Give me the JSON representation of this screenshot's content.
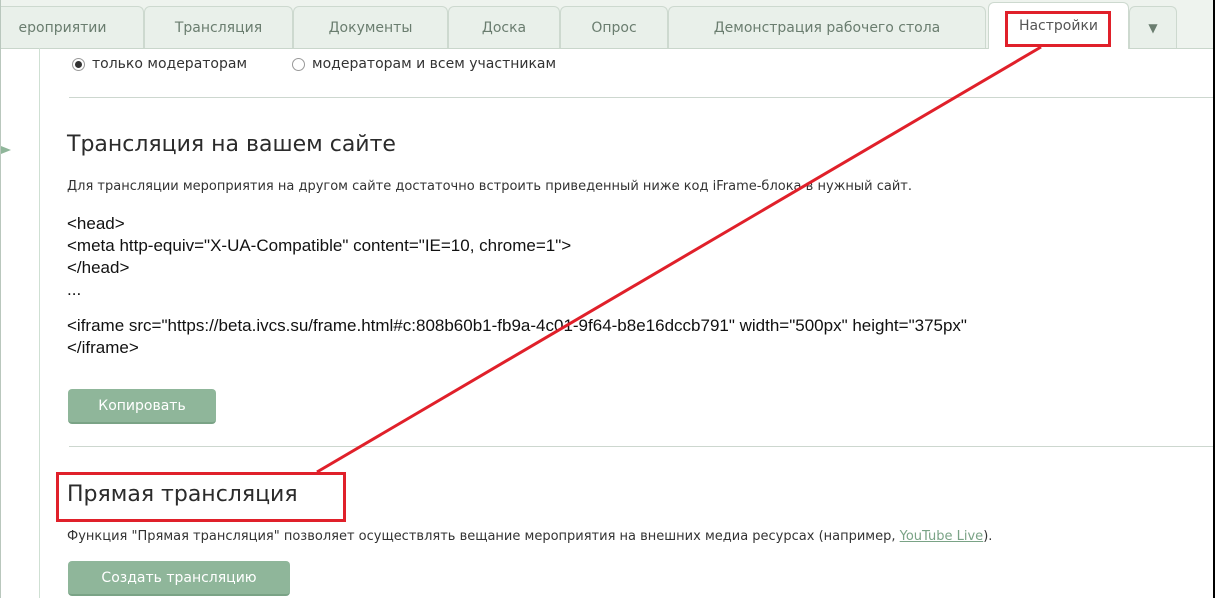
{
  "tabs": [
    {
      "label": "ероприятии"
    },
    {
      "label": "Трансляция"
    },
    {
      "label": "Документы"
    },
    {
      "label": "Доска"
    },
    {
      "label": "Опрос"
    },
    {
      "label": "Демонстрация рабочего стола"
    },
    {
      "label": "Настройки"
    }
  ],
  "tab_more_icon": "▼",
  "access": {
    "option1": "только модераторам",
    "option2": "модераторам и всем участникам",
    "selected": "только модераторам"
  },
  "embed": {
    "title": "Трансляция на вашем сайте",
    "description": "Для трансляции мероприятия на другом сайте достаточно встроить приведенный ниже код iFrame-блока в нужный сайт.",
    "code_lines": [
      "<head>",
      "<meta http-equiv=\"X-UA-Compatible\" content=\"IE=10, chrome=1\">",
      "</head>",
      "...",
      "<iframe src=\"https://beta.ivcs.su/frame.html#c:808b60b1-fb9a-4c01-9f64-b8e16dccb791\" width=\"500px\" height=\"375px\"",
      "</iframe>"
    ],
    "copy_button": "Копировать"
  },
  "live": {
    "title": "Прямая трансляция",
    "description_prefix": "Функция \"Прямая трансляция\" позволяет осуществлять вещание мероприятия на внешних медиа ресурсах (например, ",
    "link_text": "YouTube Live",
    "description_suffix": ").",
    "create_button": "Создать трансляцию"
  },
  "colors": {
    "accent_green": "#8fb69a",
    "annotation_red": "#e0202a"
  }
}
